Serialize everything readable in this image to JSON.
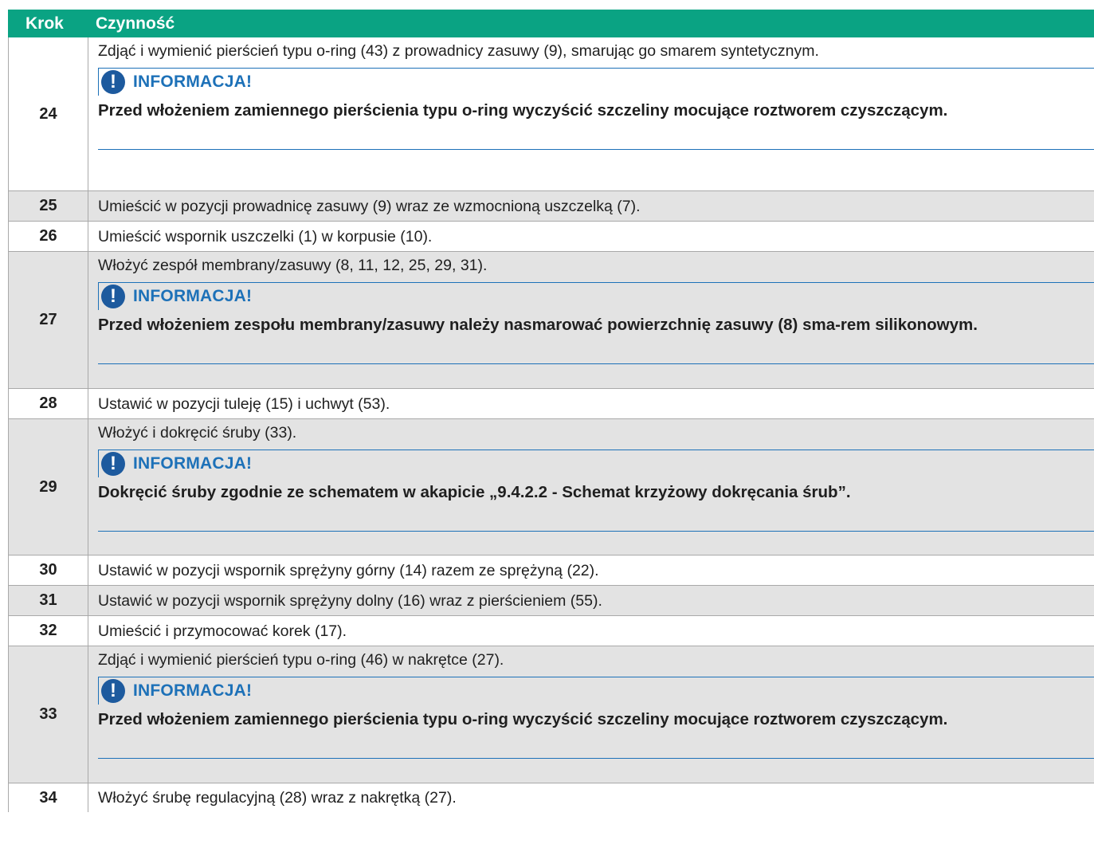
{
  "header": {
    "step": "Krok",
    "action": "Czynność"
  },
  "note_title": "INFORMACJA!",
  "note_icon": "exclamation-icon",
  "colors": {
    "header_bg": "#0aa383",
    "note_blue": "#1d71b8",
    "row_shaded": "#e3e3e3"
  },
  "rows": [
    {
      "step": "24",
      "text": "Zdjąć i wymienić pierścień typu o-ring (43) z prowadnicy zasuwy (9), smarując go smarem syntetycznym.",
      "note": "Przed włożeniem zamiennego pierścienia typu o-ring wyczyścić szczeliny mocujące roztworem czyszczącym."
    },
    {
      "step": "25",
      "text": "Umieścić w pozycji prowadnicę zasuwy (9) wraz ze wzmocnioną uszczelką (7)."
    },
    {
      "step": "26",
      "text": "Umieścić wspornik uszczelki (1) w korpusie (10)."
    },
    {
      "step": "27",
      "text": "Włożyć zespół membrany/zasuwy (8, 11, 12, 25, 29, 31).",
      "note": "Przed włożeniem zespołu membrany/zasuwy należy nasmarować powierzchnię zasuwy (8) sma-rem silikonowym."
    },
    {
      "step": "28",
      "text": "Ustawić w pozycji tuleję (15) i uchwyt (53)."
    },
    {
      "step": "29",
      "text": "Włożyć i dokręcić śruby (33).",
      "note": "Dokręcić śruby zgodnie ze schematem w akapicie „9.4.2.2 - Schemat krzyżowy dokręcania śrub”."
    },
    {
      "step": "30",
      "text": "Ustawić w pozycji wspornik sprężyny górny (14) razem ze sprężyną (22)."
    },
    {
      "step": "31",
      "text": "Ustawić w pozycji wspornik sprężyny dolny (16) wraz z pierścieniem (55)."
    },
    {
      "step": "32",
      "text": "Umieścić i przymocować korek (17)."
    },
    {
      "step": "33",
      "text": "Zdjąć i wymienić pierścień typu o-ring (46) w nakrętce (27).",
      "note": "Przed włożeniem zamiennego pierścienia typu o-ring wyczyścić szczeliny mocujące roztworem czyszczącym."
    },
    {
      "step": "34",
      "text": "Włożyć śrubę regulacyjną (28) wraz z nakrętką (27)."
    }
  ]
}
